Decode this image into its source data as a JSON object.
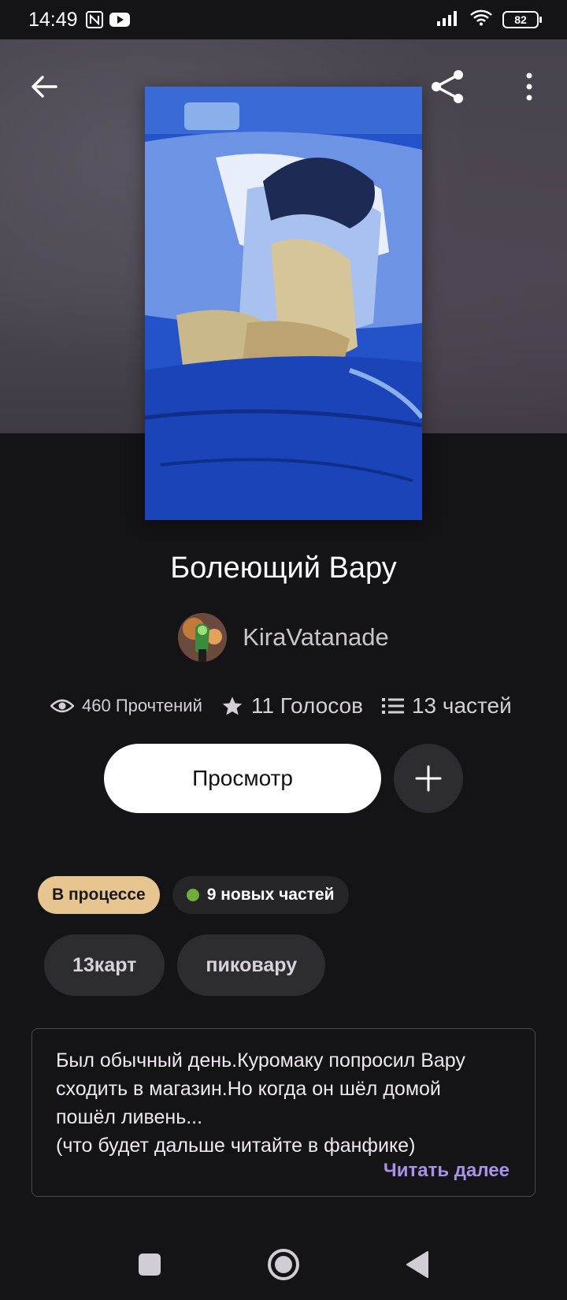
{
  "status_bar": {
    "time": "14:49",
    "battery": "82",
    "icons": [
      "nfc-icon",
      "youtube-icon",
      "signal-icon",
      "wifi-icon",
      "battery-icon"
    ]
  },
  "header": {
    "back_icon": "arrow-left-icon",
    "share_icon": "share-icon",
    "more_icon": "more-vertical-icon"
  },
  "story": {
    "title": "Болеющий Вару",
    "author": "KiraVatanade"
  },
  "stats": {
    "reads": "460 Прочтений",
    "votes": "11 Голосов",
    "parts": "13 частей"
  },
  "actions": {
    "read_label": "Просмотр",
    "add_icon": "plus-icon"
  },
  "badges": {
    "status": "В процессе",
    "new_parts": "9 новых частей"
  },
  "tags": [
    "13карт",
    "пиковару"
  ],
  "description": {
    "text": "Был обычный день.Куромаку попросил Вару\nсходить в магазин.Но когда он шёл домой\nпошёл ливень...\n(что будет дальше читайте в фанфике)",
    "read_more": "Читать далее"
  },
  "colors": {
    "background": "#141316",
    "status_badge": "#e6c591",
    "new_dot": "#6fae3c",
    "link": "#a792e8"
  }
}
